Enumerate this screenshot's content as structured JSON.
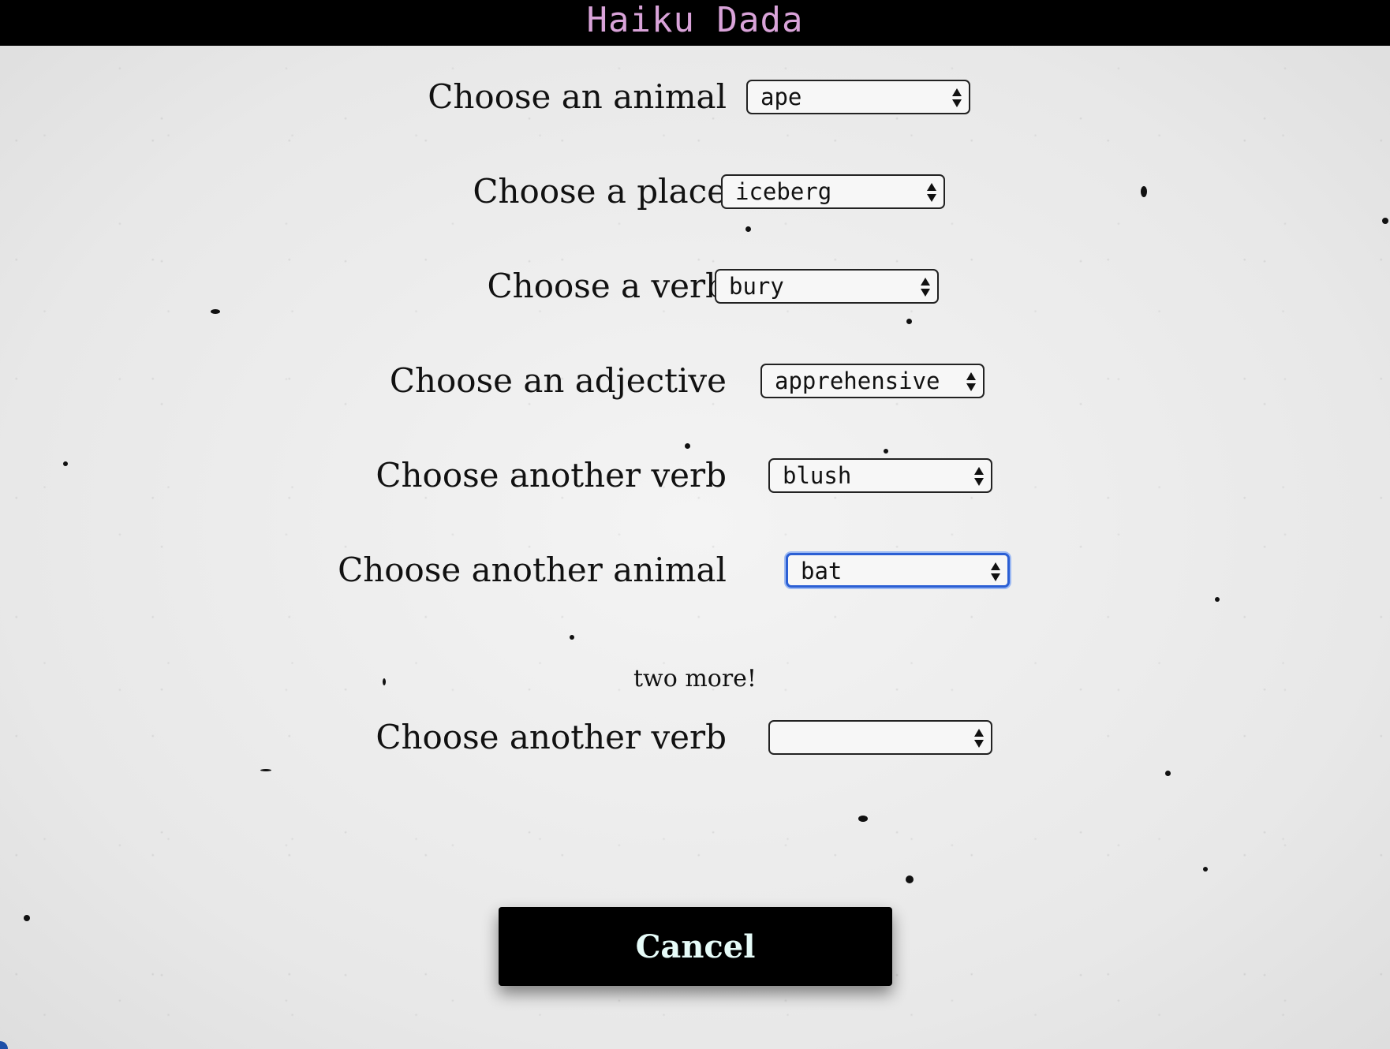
{
  "header": {
    "title": "Haiku Dada"
  },
  "form": {
    "fields": [
      {
        "label": "Choose an animal",
        "value": "ape"
      },
      {
        "label": "Choose a place",
        "value": "iceberg"
      },
      {
        "label": "Choose a verb",
        "value": "bury"
      },
      {
        "label": "Choose an adjective",
        "value": "apprehensive"
      },
      {
        "label": "Choose another verb",
        "value": "blush"
      },
      {
        "label": "Choose another animal",
        "value": "bat"
      }
    ],
    "hint": "two more!",
    "next_field": {
      "label": "Choose another verb",
      "value": ""
    }
  },
  "actions": {
    "cancel_label": "Cancel"
  },
  "colors": {
    "header_bg": "#000000",
    "title": "#d9a3d9",
    "button_bg": "#000000",
    "button_text": "#e6fbf8",
    "focus_ring": "#2b5fd4"
  },
  "icons": [
    "chevron-updown-icon"
  ]
}
